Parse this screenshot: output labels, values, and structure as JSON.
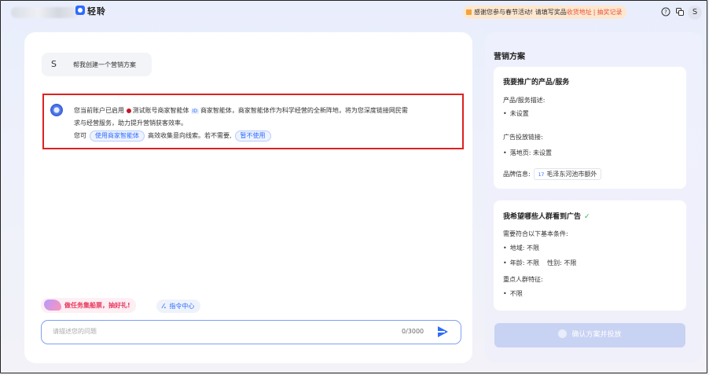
{
  "header": {
    "logo_text": "轻聆",
    "notice": {
      "text": "感谢您参与春节活动! 请填写奖品",
      "link1": "收货地址",
      "separator": "|",
      "link2": "抽奖记录"
    },
    "icons": [
      "help-icon",
      "translate-icon"
    ],
    "avatar_letter": "S"
  },
  "chat": {
    "user_avatar": "S",
    "user_message": "帮我创建一个营销方案",
    "bot": {
      "line1_a": "您当前账户已启用",
      "agent_name": "测试账号商家智能体",
      "agent_id": "ID",
      "line1_b": "商家智能体，商家智能体作为科学经营的全新阵地，将为您深度链接网民需",
      "line2": "求与经营服务，助力提升营销获客效率。",
      "line3_a": "您可",
      "use_button": "使用商家智能体",
      "line3_b": "高效收集意向线索。若不需要,",
      "skip_button": "暂不使用"
    },
    "promo_label": "做任务集船票，抽好礼!",
    "command_label": "指令中心",
    "input_placeholder": "请描述您的问题",
    "counter": "0/3000"
  },
  "plan": {
    "title": "营销方案",
    "product_card": {
      "title": "我要推广的产品/服务",
      "desc_label": "产品/服务描述:",
      "desc_value": "未设置",
      "link_label": "广告投放链接:",
      "link_value": "落地页: 未设置",
      "brand_label": "品牌信息:",
      "brand_num": "17",
      "brand_value": "毛泽东河池市额外"
    },
    "audience_card": {
      "title": "我希望哪些人群看到广告",
      "basic_label": "需要符合以下基本条件:",
      "region": "地域: 不限",
      "age_gender": "年龄: 不限    性别: 不限",
      "key_label": "重点人群特征:",
      "key_value": "不限"
    },
    "confirm_button": "确认方案并投放"
  },
  "colors": {
    "accent": "#2f6bff",
    "highlight_border": "#e02020",
    "promo_text": "#e8365d",
    "notice_bg": "#fde7cf"
  }
}
